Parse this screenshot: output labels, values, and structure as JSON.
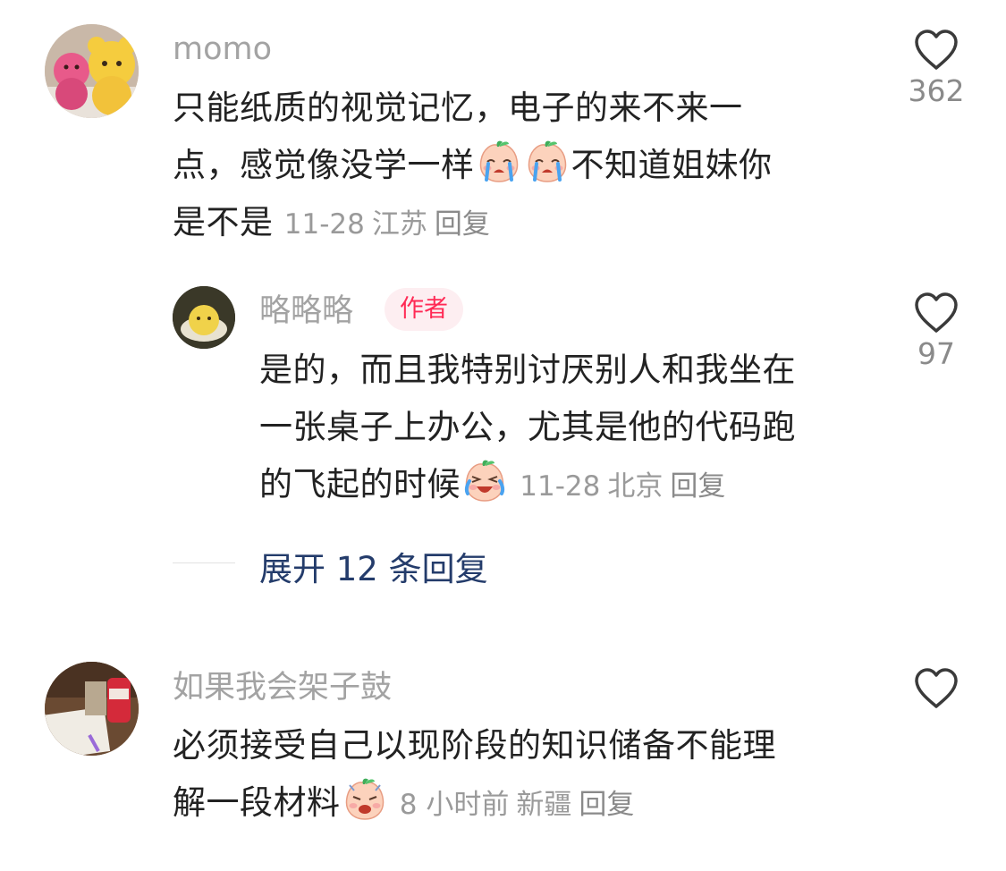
{
  "comments": [
    {
      "author": "momo",
      "lines": [
        "只能纸质的视觉记忆，电子的来不来一",
        "点，感觉像没学一样",
        "不知道姐妹你",
        "是不是"
      ],
      "emojis": [
        "crying-emoji",
        "crying-emoji"
      ],
      "date": "11-28",
      "location": "江苏",
      "reply_label": "回复",
      "likes": "362",
      "replies": [
        {
          "author": "略略略",
          "badge": "作者",
          "lines": [
            "是的，而且我特别讨厌别人和我坐在",
            "一张桌子上办公，尤其是他的代码跑",
            "的飞起的时候"
          ],
          "emoji": "laugh-cry-emoji",
          "date": "11-28",
          "location": "北京",
          "reply_label": "回复",
          "likes": "97"
        }
      ],
      "expand_label": "展开 12 条回复"
    },
    {
      "author": "如果我会架子鼓",
      "lines": [
        "必须接受自己以现阶段的知识储备不能理",
        "解一段材料"
      ],
      "emoji": "upset-emoji",
      "time": "8 小时前",
      "location": "新疆",
      "reply_label": "回复"
    }
  ],
  "colors": {
    "text": "#222222",
    "meta": "#9a9a9a",
    "author": "#a3a3a3",
    "badge_text": "#ff2a55",
    "badge_bg": "#fdeef1",
    "expand_link": "#243c6b"
  }
}
